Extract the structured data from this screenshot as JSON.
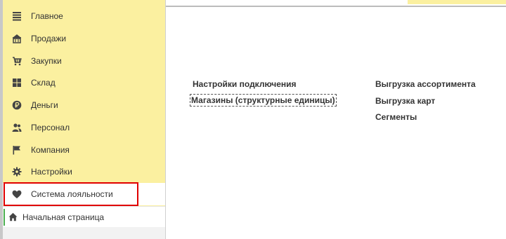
{
  "sidebar": {
    "items": [
      {
        "label": "Главное",
        "icon": "menu-lines-icon"
      },
      {
        "label": "Продажи",
        "icon": "store-basket-icon"
      },
      {
        "label": "Закупки",
        "icon": "shopping-cart-icon"
      },
      {
        "label": "Склад",
        "icon": "warehouse-grid-icon"
      },
      {
        "label": "Деньги",
        "icon": "coin-ruble-icon"
      },
      {
        "label": "Персонал",
        "icon": "people-icon"
      },
      {
        "label": "Компания",
        "icon": "flag-icon"
      },
      {
        "label": "Настройки",
        "icon": "gear-icon"
      },
      {
        "label": "Система лояльности",
        "icon": "heart-icon"
      }
    ],
    "home": {
      "label": "Начальная страница",
      "icon": "home-icon"
    }
  },
  "main": {
    "left_links": [
      "Настройки подключения",
      "Магазины (структурные единицы)"
    ],
    "right_links": [
      "Выгрузка ассортимента",
      "Выгрузка карт",
      "Сегменты"
    ]
  },
  "colors": {
    "sidebar_bg": "#fbf0a0",
    "highlight_border": "#e00000",
    "active_indicator": "#4caf50"
  }
}
